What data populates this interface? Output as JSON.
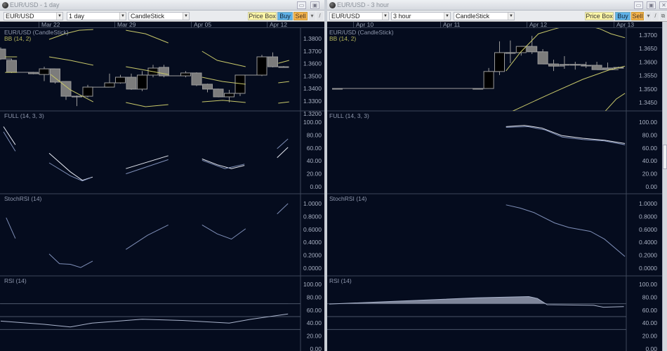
{
  "windows": [
    {
      "title": "EUR/USD - 1 day",
      "symbol": "EUR/USD",
      "interval": "1 day",
      "chart_type": "CandleStick",
      "buttons": {
        "price_box": "Price Box",
        "buy": "Buy",
        "sell": "Sell",
        "dropdown_icon": "▾",
        "draw_icon": "/"
      },
      "window_buttons": {
        "minimize": "▭",
        "maximize": "▣"
      },
      "dates": [
        "Mar 22",
        "Mar 29",
        "Apr 05",
        "Apr 12"
      ],
      "indicator_labels": {
        "price": "EUR/USD (CandleStick)",
        "bb": "BB (14, 2)",
        "full": "FULL (14, 3, 3)",
        "stochrsi": "StochRSI (14)",
        "rsi": "RSI (14)"
      }
    },
    {
      "title": "EUR/USD - 3 hour",
      "symbol": "EUR/USD",
      "interval": "3 hour",
      "chart_type": "CandleStick",
      "buttons": {
        "price_box": "Price Box",
        "buy": "Buy",
        "sell": "Sell",
        "dropdown_icon": "▾",
        "draw_icon": "/"
      },
      "window_buttons": {
        "minimize": "▭",
        "maximize": "▣",
        "close": "✕"
      },
      "dates": [
        "Apr 10",
        "Apr 11",
        "Apr 12",
        "Apr 13"
      ],
      "indicator_labels": {
        "price": "EUR/USD (CandleStick)",
        "bb": "BB (14, 2)",
        "full": "FULL (14, 3, 3)",
        "stochrsi": "StochRSI (14)",
        "rsi": "RSI (14)"
      }
    }
  ],
  "colors": {
    "background": "#050c1e",
    "grid": "#3d4659",
    "bb": "#c8c86a",
    "candle_down": "#7c7c7c",
    "candle_up": "#000000",
    "osc": "#aab4cc",
    "rsi_fill": "#7f869a"
  },
  "chart_data": [
    {
      "type": "candlestick",
      "title": "EUR/USD - 1 day",
      "price_ticks": [
        "1.3800",
        "1.3700",
        "1.3600",
        "1.3500",
        "1.3400",
        "1.3300",
        "1.3200"
      ],
      "price_tick_values": [
        1.38,
        1.37,
        1.36,
        1.35,
        1.34,
        1.33,
        1.32
      ],
      "ylim_price": [
        1.3165,
        1.3885
      ],
      "candles": [
        {
          "i": 0,
          "o": 1.3716,
          "h": 1.373,
          "l": 1.363,
          "c": 1.3637
        },
        {
          "i": 1,
          "o": 1.3626,
          "h": 1.364,
          "l": 1.3525,
          "c": 1.353
        },
        {
          "i": 3,
          "o": 1.353,
          "h": 1.3534,
          "l": 1.3515,
          "c": 1.3519
        },
        {
          "i": 4,
          "o": 1.3513,
          "h": 1.3575,
          "l": 1.346,
          "c": 1.3558
        },
        {
          "i": 5,
          "o": 1.3558,
          "h": 1.356,
          "l": 1.344,
          "c": 1.3452
        },
        {
          "i": 6,
          "o": 1.3457,
          "h": 1.346,
          "l": 1.331,
          "c": 1.3339
        },
        {
          "i": 7,
          "o": 1.3339,
          "h": 1.3345,
          "l": 1.326,
          "c": 1.3339
        },
        {
          "i": 8,
          "o": 1.3339,
          "h": 1.343,
          "l": 1.333,
          "c": 1.3412
        },
        {
          "i": 10,
          "o": 1.3412,
          "h": 1.352,
          "l": 1.341,
          "c": 1.3446
        },
        {
          "i": 11,
          "o": 1.3446,
          "h": 1.351,
          "l": 1.344,
          "c": 1.3491
        },
        {
          "i": 12,
          "o": 1.3491,
          "h": 1.352,
          "l": 1.339,
          "c": 1.3396
        },
        {
          "i": 13,
          "o": 1.3396,
          "h": 1.354,
          "l": 1.338,
          "c": 1.3508
        },
        {
          "i": 14,
          "o": 1.3508,
          "h": 1.359,
          "l": 1.349,
          "c": 1.3564
        },
        {
          "i": 15,
          "o": 1.357,
          "h": 1.359,
          "l": 1.349,
          "c": 1.3502
        },
        {
          "i": 17,
          "o": 1.3502,
          "h": 1.354,
          "l": 1.349,
          "c": 1.3525
        },
        {
          "i": 18,
          "o": 1.3525,
          "h": 1.353,
          "l": 1.342,
          "c": 1.3429
        },
        {
          "i": 19,
          "o": 1.3435,
          "h": 1.344,
          "l": 1.337,
          "c": 1.3396
        },
        {
          "i": 20,
          "o": 1.3396,
          "h": 1.34,
          "l": 1.333,
          "c": 1.3334
        },
        {
          "i": 21,
          "o": 1.3334,
          "h": 1.339,
          "l": 1.329,
          "c": 1.3362
        },
        {
          "i": 22,
          "o": 1.3362,
          "h": 1.351,
          "l": 1.334,
          "c": 1.3508
        },
        {
          "i": 24,
          "o": 1.3508,
          "h": 1.367,
          "l": 1.35,
          "c": 1.3654
        },
        {
          "i": 25,
          "o": 1.3654,
          "h": 1.369,
          "l": 1.357,
          "c": 1.3575
        },
        {
          "i": 26,
          "o": 1.3575,
          "h": 1.358,
          "l": 1.357,
          "c": 1.3575
        }
      ],
      "bb_upper": [
        [
          [
            0.4,
            1.3654
          ],
          [
            1.5,
            1.3654
          ]
        ],
        [
          [
            4.45,
            1.3794
          ],
          [
            5.9,
            1.3839
          ],
          [
            7.2,
            1.3867
          ],
          [
            8.5,
            1.3873
          ]
        ],
        [
          [
            11.5,
            1.3867
          ],
          [
            13.3,
            1.3839
          ],
          [
            15.4,
            1.3766
          ]
        ],
        [
          [
            18.5,
            1.3699
          ],
          [
            19.9,
            1.3626
          ],
          [
            22.5,
            1.3575
          ]
        ],
        [
          [
            25.5,
            1.3603
          ],
          [
            26.5,
            1.3626
          ]
        ]
      ],
      "bb_middle": [
        [
          [
            4.45,
            1.3654
          ],
          [
            6.4,
            1.3626
          ],
          [
            8.5,
            1.3587
          ]
        ],
        [
          [
            11.5,
            1.3575
          ],
          [
            13.3,
            1.3547
          ],
          [
            15.4,
            1.3513
          ]
        ],
        [
          [
            18.5,
            1.3491
          ],
          [
            20.4,
            1.3457
          ],
          [
            22.5,
            1.3435
          ]
        ],
        [
          [
            25.5,
            1.3446
          ],
          [
            26.5,
            1.3457
          ]
        ]
      ],
      "bb_lower": [
        [
          [
            0.4,
            1.353
          ],
          [
            1.5,
            1.353
          ]
        ],
        [
          [
            4.6,
            1.3513
          ],
          [
            6.4,
            1.339
          ],
          [
            8.5,
            1.3294
          ]
        ],
        [
          [
            11.5,
            1.3289
          ],
          [
            13.3,
            1.3255
          ],
          [
            15.4,
            1.3272
          ]
        ],
        [
          [
            18.5,
            1.3294
          ],
          [
            20.4,
            1.3306
          ],
          [
            22.5,
            1.3289
          ]
        ],
        [
          [
            25.5,
            1.3283
          ],
          [
            26.5,
            1.3294
          ]
        ]
      ],
      "osc_ticks": [
        "100.00",
        "80.00",
        "60.00",
        "40.00",
        "20.00",
        "0.00"
      ],
      "osc_tick_values": [
        100,
        80,
        60,
        40,
        20,
        0
      ],
      "stochrsi_ticks": [
        "1.0000",
        "0.8000",
        "0.6000",
        "0.4000",
        "0.2000",
        "0.0000"
      ],
      "stochrsi_tick_values": [
        1,
        0.8,
        0.6,
        0.4,
        0.2,
        0
      ],
      "full_k": [
        [
          [
            0.26,
            93
          ],
          [
            1.35,
            65
          ]
        ],
        [
          [
            4.45,
            52
          ],
          [
            6.4,
            23
          ],
          [
            7.5,
            10
          ],
          [
            8.45,
            15
          ]
        ],
        [
          [
            11.5,
            28
          ],
          [
            15.4,
            48
          ]
        ],
        [
          [
            18.5,
            43
          ],
          [
            19.9,
            34
          ],
          [
            21.2,
            28
          ],
          [
            22.4,
            33
          ]
        ],
        [
          [
            25.4,
            45
          ],
          [
            26.4,
            61
          ]
        ]
      ],
      "full_d": [
        [
          [
            0.26,
            85
          ],
          [
            1.35,
            55
          ]
        ],
        [
          [
            4.45,
            37
          ],
          [
            6.4,
            17
          ],
          [
            7.5,
            9
          ],
          [
            8.3,
            14
          ]
        ],
        [
          [
            11.5,
            20
          ],
          [
            15.4,
            42
          ]
        ],
        [
          [
            18.5,
            41
          ],
          [
            20.6,
            28
          ],
          [
            22.4,
            35
          ]
        ],
        [
          [
            25.4,
            59
          ],
          [
            26.4,
            74
          ]
        ]
      ],
      "stochrsi": [
        [
          [
            0.5,
            0.78
          ],
          [
            1.35,
            0.46
          ]
        ],
        [
          [
            4.45,
            0.22
          ],
          [
            5.4,
            0.07
          ],
          [
            6.4,
            0.06
          ],
          [
            7.35,
            0.01
          ],
          [
            8.45,
            0.11
          ]
        ],
        [
          [
            11.5,
            0.29
          ],
          [
            13.5,
            0.51
          ],
          [
            15.4,
            0.67
          ]
        ],
        [
          [
            18.5,
            0.67
          ],
          [
            19.9,
            0.53
          ],
          [
            21.2,
            0.45
          ],
          [
            22.5,
            0.61
          ]
        ],
        [
          [
            25.4,
            0.84
          ],
          [
            26.4,
            1.0
          ]
        ]
      ],
      "rsi": [
        [
          0,
          43
        ],
        [
          4,
          38
        ],
        [
          6.4,
          34
        ],
        [
          8.4,
          40
        ],
        [
          13,
          46
        ],
        [
          16.7,
          44
        ],
        [
          21,
          40
        ],
        [
          23,
          46
        ],
        [
          26.4,
          54
        ]
      ],
      "rsi_levels": [
        70,
        50,
        30
      ]
    },
    {
      "type": "candlestick",
      "title": "EUR/USD - 3 hour",
      "price_ticks": [
        "1.3700",
        "1.3650",
        "1.3600",
        "1.3550",
        "1.3500",
        "1.3450"
      ],
      "price_tick_values": [
        1.37,
        1.365,
        1.36,
        1.355,
        1.35,
        1.345
      ],
      "ylim_price": [
        1.3399,
        1.3726
      ],
      "candles": [
        {
          "i": 0,
          "o": 1.3502,
          "h": 1.3502,
          "l": 1.3502,
          "c": 1.3502
        },
        {
          "i": 13,
          "o": 1.3502,
          "h": 1.3502,
          "l": 1.3502,
          "c": 1.3502
        },
        {
          "i": 14,
          "o": 1.3502,
          "h": 1.3578,
          "l": 1.3502,
          "c": 1.3565
        },
        {
          "i": 15,
          "o": 1.3565,
          "h": 1.3677,
          "l": 1.3552,
          "c": 1.3635
        },
        {
          "i": 16,
          "o": 1.3635,
          "h": 1.368,
          "l": 1.3596,
          "c": 1.3635
        },
        {
          "i": 17,
          "o": 1.3635,
          "h": 1.3658,
          "l": 1.3624,
          "c": 1.3658
        },
        {
          "i": 18,
          "o": 1.3658,
          "h": 1.3697,
          "l": 1.363,
          "c": 1.3638
        },
        {
          "i": 19,
          "o": 1.3638,
          "h": 1.3648,
          "l": 1.3593,
          "c": 1.3593
        },
        {
          "i": 20,
          "o": 1.3593,
          "h": 1.3609,
          "l": 1.3567,
          "c": 1.3585
        },
        {
          "i": 21,
          "o": 1.3591,
          "h": 1.3622,
          "l": 1.3575,
          "c": 1.3591
        },
        {
          "i": 22,
          "o": 1.3591,
          "h": 1.3601,
          "l": 1.3572,
          "c": 1.3591
        },
        {
          "i": 23,
          "o": 1.3588,
          "h": 1.3601,
          "l": 1.3578,
          "c": 1.3588
        },
        {
          "i": 24,
          "o": 1.3588,
          "h": 1.3601,
          "l": 1.3572,
          "c": 1.3572
        },
        {
          "i": 25,
          "o": 1.3578,
          "h": 1.3598,
          "l": 1.3572,
          "c": 1.3572
        },
        {
          "i": 26,
          "o": 1.358,
          "h": 1.3583,
          "l": 1.3578,
          "c": 1.358
        }
      ],
      "bb_upper": [
        [
          [
            15.6,
            1.3567
          ],
          [
            16.9,
            1.3635
          ],
          [
            18.6,
            1.3705
          ],
          [
            20.1,
            1.3723
          ],
          [
            22.2,
            1.3745
          ],
          [
            24.3,
            1.3723
          ],
          [
            25.3,
            1.3705
          ],
          [
            26.6,
            1.369
          ]
        ]
      ],
      "bb_middle": [
        [
          [
            16.0,
            1.3414
          ],
          [
            19.5,
            1.3479
          ],
          [
            22.7,
            1.3536
          ],
          [
            25.1,
            1.357
          ],
          [
            26.6,
            1.3585
          ]
        ]
      ],
      "bb_lower": [
        [
          [
            24.8,
            1.3419
          ],
          [
            25.8,
            1.3463
          ],
          [
            26.6,
            1.3484
          ]
        ]
      ],
      "osc_ticks": [
        "100.00",
        "80.00",
        "60.00",
        "40.00",
        "20.00",
        "0.00"
      ],
      "osc_tick_values": [
        100,
        80,
        60,
        40,
        20,
        0
      ],
      "stochrsi_ticks": [
        "1.0000",
        "0.8000",
        "0.6000",
        "0.4000",
        "0.2000",
        "0.0000"
      ],
      "stochrsi_tick_values": [
        1,
        0.8,
        0.6,
        0.4,
        0.2,
        0
      ],
      "full_k": [
        [
          [
            15.6,
            93
          ],
          [
            17.3,
            95
          ],
          [
            18.9,
            91
          ],
          [
            20.8,
            79
          ],
          [
            22.7,
            75
          ],
          [
            24.7,
            72
          ],
          [
            26.6,
            67
          ]
        ]
      ],
      "full_d": [
        [
          [
            15.6,
            92
          ],
          [
            17.6,
            93
          ],
          [
            19.2,
            88
          ],
          [
            20.8,
            77
          ],
          [
            22.7,
            73
          ],
          [
            24.7,
            71
          ],
          [
            26.6,
            65
          ]
        ]
      ],
      "stochrsi": [
        [
          [
            15.6,
            0.98
          ],
          [
            16.9,
            0.93
          ],
          [
            18.2,
            0.86
          ],
          [
            20.1,
            0.7
          ],
          [
            21.4,
            0.63
          ],
          [
            23.4,
            0.57
          ],
          [
            24.7,
            0.45
          ],
          [
            26.6,
            0.18
          ]
        ]
      ],
      "rsi": [
        [
          -0.75,
          69.5
        ],
        [
          12.9,
          79
        ],
        [
          17.7,
          81
        ],
        [
          18.5,
          78
        ],
        [
          19.4,
          68.5
        ],
        [
          23.7,
          67.5
        ],
        [
          24.6,
          64.6
        ],
        [
          26.5,
          65.5
        ]
      ],
      "rsi_levels": [
        70,
        50,
        30
      ]
    }
  ]
}
